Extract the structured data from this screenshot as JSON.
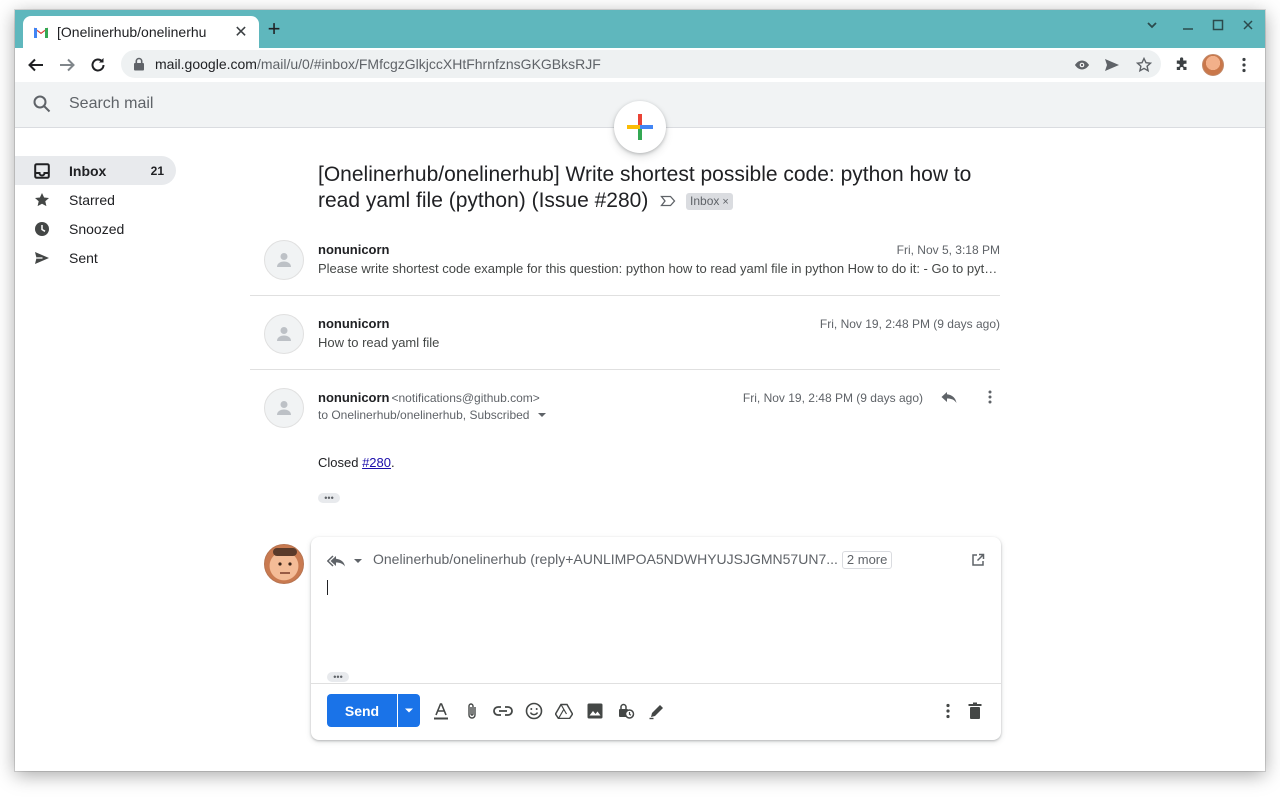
{
  "browser": {
    "tab_title": "[Onelinerhub/onelinerhu",
    "url_host": "mail.google.com",
    "url_path": "/mail/u/0/#inbox/FMfcgzGlkjccXHtFhrnfznsGKGBksRJF",
    "new_tab_label": "+",
    "tab_close_label": "✕"
  },
  "search": {
    "placeholder": "Search mail"
  },
  "sidebar": {
    "items": [
      {
        "label": "Inbox",
        "count": "21",
        "icon": "inbox-icon"
      },
      {
        "label": "Starred",
        "count": "",
        "icon": "star-icon"
      },
      {
        "label": "Snoozed",
        "count": "",
        "icon": "clock-icon"
      },
      {
        "label": "Sent",
        "count": "",
        "icon": "send-icon"
      }
    ]
  },
  "thread": {
    "subject": "[Onelinerhub/onelinerhub] Write shortest possible code: python how to read yaml file (python) (Issue #280)",
    "label": "Inbox",
    "label_remove": "×",
    "messages": [
      {
        "sender": "nonunicorn",
        "date": "Fri, Nov 5, 3:18 PM",
        "snippet": "Please write shortest code example for this question: python how to read yaml file in python How to do it: - Go to python"
      },
      {
        "sender": "nonunicorn",
        "date": "Fri, Nov 19, 2:48 PM (9 days ago)",
        "snippet": "How to read yaml file"
      },
      {
        "sender": "nonunicorn",
        "sender_email": "<notifications@github.com>",
        "date": "Fri, Nov 19, 2:48 PM (9 days ago)",
        "to": "to Onelinerhub/onelinerhub, Subscribed",
        "body_prefix": "Closed ",
        "body_link": "#280",
        "body_suffix": ".",
        "dots": "•••"
      }
    ]
  },
  "reply": {
    "to": "Onelinerhub/onelinerhub (reply+AUNLIMPOA5NDWHYUJSJGMN57UN7...",
    "more": "2 more",
    "dots": "•••",
    "send_label": "Send"
  },
  "colors": {
    "tabstrip": "#5fb7bd",
    "send_button": "#1a73e8",
    "link": "#1a0dab"
  }
}
